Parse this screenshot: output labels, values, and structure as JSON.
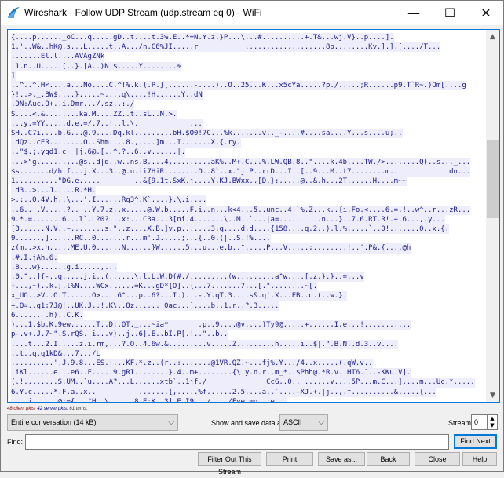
{
  "window": {
    "title": "Wireshark · Follow UDP Stream (udp.stream eq 0) · WiFi",
    "minimize": "—",
    "maximize": "☐",
    "close": "✕"
  },
  "colors": {
    "server_text": "#1b1b8a",
    "server_bg": "#ededfb",
    "client_text": "#8b0000",
    "accent": "#0078d7"
  },
  "stream_lines": [
    "{....p......_oC...q.....gD..t....t.3%.E..*=N.Y.z.}P...\\...#..........+.T&...wj.V}..p....].",
    "1.'..W&..hK@.s...L.....t..A.../n.C6%JI.....r           ...................8p........Kv.].].[..../T...",
    ".......El.l....AVAgZNk",
    ".1.n..U.....(..}.[A..)N.$.....Y........%",
    "]",
    "..^..^.H<....a...No....C.^!%.k.(.P.}[......-....)..O..25...K...x5cYa.....?p./.....;R......p9.T`R~.)Om[....g",
    "}!..>._.BW$....}.....~....q\\....!H......Y..dN",
    ".DN:Auc.O+..i.Dmr.../.sz..:./",
    "S....<.&........ka.M....ZZ..t..sL..N.>.",
    "...y.=YY.....d.e.=/.7..!..l.\\.            ...",
    "SH..C7i....b.G...@.9....Dq.kl.........bH.$O0!7C...%k.......v.._-....#....sa....Y...s....u;..",
    ".dQz..cER........O..Shm....8.,....]m...I.......X.{.ry.",
    "..\"$.;.ygd1.c  |j.6@.[..^.?..6..v......|.",
    "...>\"g.......,..@s..d|d.,w..ns.B....4,.........aK%..M+.C...%.LW.QB.8..\"....k.4b....TW./>........Q)..s..._...",
    "$s.......d/h.f...j.X...3..@.u.ii7HiR........O..8`..x.\"j.P..rrD...I..[..9...M..t7........m..            dn...",
    "1..........\"DG.e.....        ..&{9.1t.SxK.j....Y.KJ.BWxx..[D.}:.....@..&.h...2T......H....m~~",
    ".d3..>...J.....R.*H.",
    ">.:..O.4V.h..\\...'.I......Rg3^.K`....}.\\.i....",
    "..6.._.V.....?.._..Y.7.z..x.....@.W.b.....F.i..n...k<4...5..unc..4_`%.Z...k..{i.Fo.<....6.=.!..w^..r...zR...",
    "9.*.=.......6...l`.L?0?...x:...C3a...3[ni.4.......\\..M..`...|a=.....    .n...}..7.6.RT.R!.+.6...,.y...",
    "[3......N.V..~........s.\"..z....X.B.]v.p.......3.q....d.d....{158....q.2..).l.%.....`..0!.......0..x.{.",
    "9......,]......RC..0.......r...m'.J.....;...{..0.(|..S.!%....",
    "z(m..>x.h.....ME.U.0......N......}W......5...u...e.b..^.....P...V.....;........!..'.P&.{....@h",
    ".#.I.jAh.6.",
    ".8...w}......g.i.....,...",
    ".0.^..]{-..q.....j.i..(......\\.l.L.W.D(#./.........(w.........a^w....[.z.}.}..=...v",
    "+...,~)..k.;.l%N....WCx.l....=K...gD*{O]..{...7.......7...[.\"........~[.",
    "x_UO..>V..O.T......O>....6^...p..6?...I.)...-.Y.qT.3....s&.q'.X...FB..o.(..w.}.",
    "+.Q=..q1;7J@|..UK.J..!.K\\..Qz...... 0ac...]....b..1.r..?.3.....",
    "6...... .h)..C.K.",
    ")...1.$b.K.9ew......T..D;.OT._...~ia*       .p..9....@v....)Ty9@.....+.....,I,e...!...........",
    "p-.v+.J.7~\".S.rQS. i...v)..j..6}.E..bI.P[.!..\"..b..",
    "....t...2.I.....z.i.rm,...?.O..4.6w.&.........v.....Z.........h.....i..$|.\".B.N..d.3..v....",
    "..t..q.q1kD&...7.../L",
    "..........'.J.9.8...ES.|...KF.*.z..(r..:.......@1VR.QZ.~...fj%.Y.../4..x.....(.qW.v..",
    ".iKl......e...e6..F.....9.gRI........}.4..m+........{\\.y.n.r..m_*..$Phh@.*R.v..HT6.J..-KKu.V].",
    "(.!........S.UM..`u....A?...L......xtb`..1jf./              CcG..0.._......v....5P...m.C...]....m...Uc.*.....",
    "6.Y.c.....*.F.a..x..          .......{,.....%f......2.5....a..`....-XJ.+.|j..,.f..........&.....{...",
    "....j.. ...@:={...\"H..\\..... 8.E;K..3].E.I9.._/..../Fye.mq..;e..."
  ],
  "status": {
    "client": "48 client pkts,",
    "server": "42 server pkts,",
    "turns": "61 turns."
  },
  "controls": {
    "conversation": "Entire conversation (14 kB)",
    "show_label": "Show and save data as",
    "format": "ASCII",
    "stream_label": "Stream",
    "stream_value": "0",
    "find_label": "Find:",
    "find_value": "",
    "find_next": "Find Next"
  },
  "buttons": {
    "filter_out": "Filter Out This Stream",
    "print": "Print",
    "save_as": "Save as...",
    "back": "Back",
    "close": "Close",
    "help": "Help"
  }
}
